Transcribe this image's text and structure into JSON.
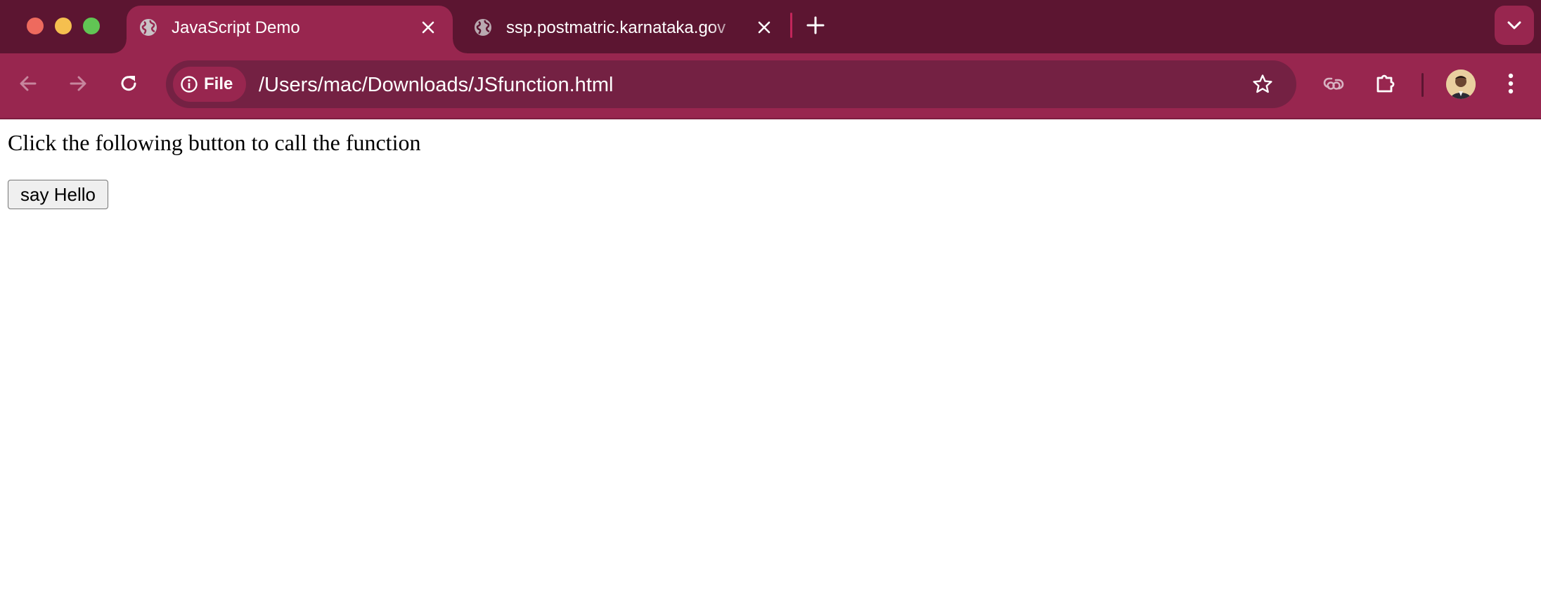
{
  "window": {
    "controls": [
      "close",
      "minimize",
      "zoom"
    ]
  },
  "tabs": [
    {
      "title": "JavaScript Demo",
      "icon": "globe-icon",
      "active": true
    },
    {
      "title": "ssp.postmatric.karnataka.gov",
      "icon": "globe-icon",
      "active": false
    }
  ],
  "toolbar": {
    "back": "arrow-left-icon",
    "forward": "arrow-right-icon",
    "reload": "reload-icon",
    "site_chip_label": "File",
    "url": "/Users/mac/Downloads/JSfunction.html"
  },
  "page": {
    "text": "Click the following button to call the function",
    "button_label": "say Hello"
  },
  "colors": {
    "tabstrip": "#5c1531",
    "toolbar": "#98264f",
    "omnibox": "#742143"
  }
}
